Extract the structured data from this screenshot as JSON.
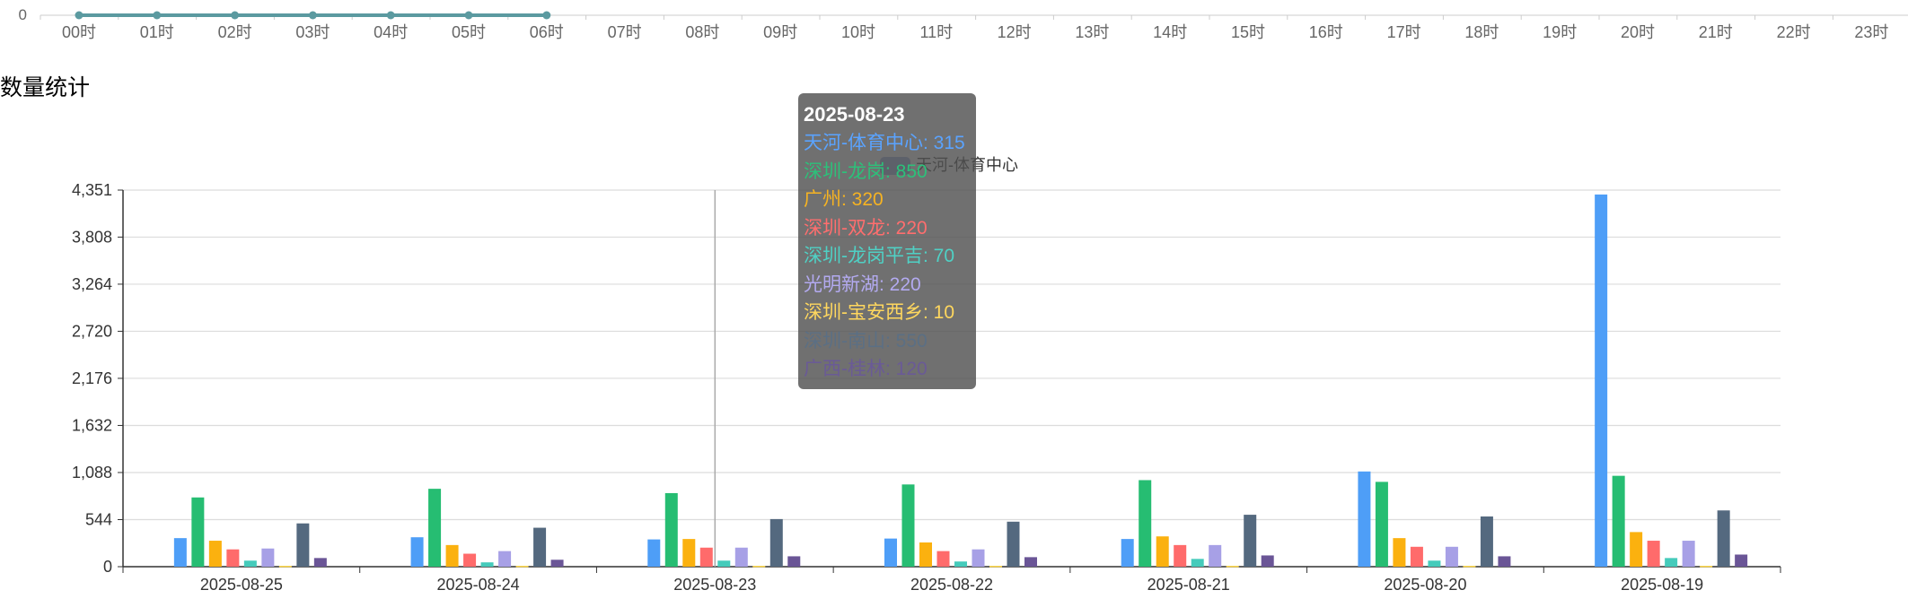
{
  "timeline": {
    "y_label": "0",
    "hours": [
      "00时",
      "01时",
      "02时",
      "03时",
      "04时",
      "05时",
      "06时",
      "07时",
      "08时",
      "09时",
      "10时",
      "11时",
      "12时",
      "13时",
      "14时",
      "15时",
      "16时",
      "17时",
      "18时",
      "19时",
      "20时",
      "21时",
      "22时",
      "23时"
    ],
    "active_until_index": 6,
    "line_color": "#5b9aa0"
  },
  "section_title": "数量统计",
  "legend": {
    "visible_entry": "天河-体育中心"
  },
  "tooltip": {
    "title": "2025-08-23",
    "rows": [
      {
        "text": "天河-体育中心: 315",
        "color": "#5aa3ff"
      },
      {
        "text": "深圳-龙岗: 850",
        "color": "#2cc17a"
      },
      {
        "text": "广州: 320",
        "color": "#f6b322"
      },
      {
        "text": "深圳-双龙: 220",
        "color": "#ff6e6e"
      },
      {
        "text": "深圳-龙岗平吉: 70",
        "color": "#4fd1c5"
      },
      {
        "text": "光明新湖: 220",
        "color": "#b3aaf0"
      },
      {
        "text": "深圳-宝安西乡: 10",
        "color": "#ffd75e"
      },
      {
        "text": "深圳-南山: 550",
        "color": "#5b6f84"
      },
      {
        "text": "广西-桂林: 120",
        "color": "#6a5a96"
      }
    ]
  },
  "chart_data": {
    "type": "bar",
    "categories": [
      "2025-08-25",
      "2025-08-24",
      "2025-08-23",
      "2025-08-22",
      "2025-08-21",
      "2025-08-20",
      "2025-08-19"
    ],
    "ylim": [
      0,
      4351
    ],
    "yticks": [
      "0",
      "544",
      "1,088",
      "1,632",
      "2,176",
      "2,720",
      "3,264",
      "3,808",
      "4,351"
    ],
    "grid": true,
    "series": [
      {
        "name": "天河-体育中心",
        "color": "#4e9ef7",
        "values": [
          330,
          340,
          315,
          325,
          320,
          1100,
          4300
        ]
      },
      {
        "name": "深圳-龙岗",
        "color": "#26bd72",
        "values": [
          800,
          900,
          850,
          950,
          1000,
          980,
          1050
        ]
      },
      {
        "name": "广州",
        "color": "#fbb10f",
        "values": [
          300,
          250,
          320,
          280,
          350,
          330,
          400
        ]
      },
      {
        "name": "深圳-双龙",
        "color": "#ff6b6b",
        "values": [
          200,
          150,
          220,
          180,
          250,
          230,
          300
        ]
      },
      {
        "name": "深圳-龙岗平吉",
        "color": "#45cbbb",
        "values": [
          70,
          50,
          70,
          60,
          90,
          70,
          100
        ]
      },
      {
        "name": "光明新湖",
        "color": "#a7a0e6",
        "values": [
          210,
          180,
          220,
          200,
          250,
          230,
          300
        ]
      },
      {
        "name": "深圳-宝安西乡",
        "color": "#ffd84a",
        "values": [
          10,
          10,
          10,
          10,
          10,
          10,
          10
        ]
      },
      {
        "name": "深圳-南山",
        "color": "#54697f",
        "values": [
          500,
          450,
          550,
          520,
          600,
          580,
          650
        ]
      },
      {
        "name": "广西-桂林",
        "color": "#6a5596",
        "values": [
          100,
          80,
          120,
          110,
          130,
          120,
          140
        ]
      }
    ],
    "highlighted_category": "2025-08-23"
  }
}
